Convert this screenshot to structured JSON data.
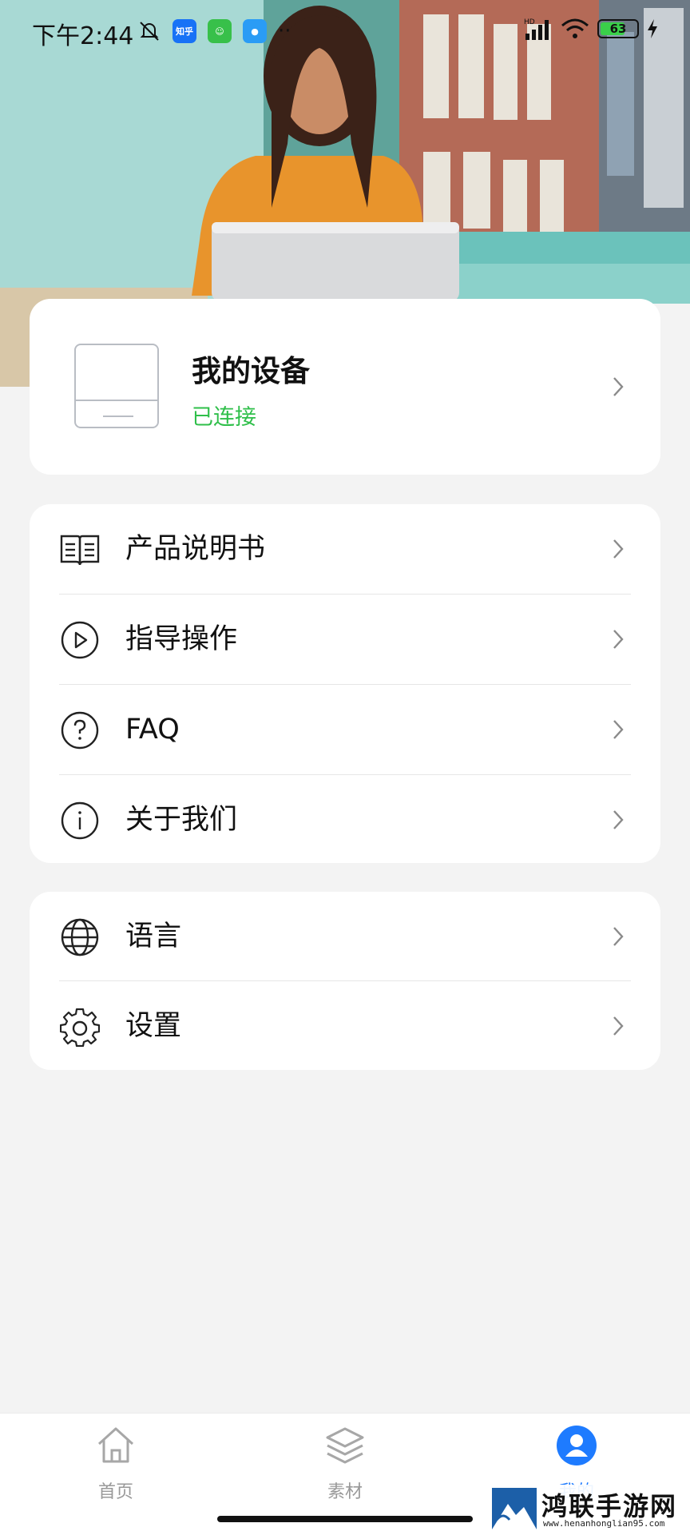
{
  "status_bar": {
    "time": "下午2:44",
    "network": "HD",
    "battery": "63"
  },
  "device": {
    "title": "我的设备",
    "status": "已连接"
  },
  "menu_group_1": [
    {
      "label": "产品说明书",
      "icon": "book-icon"
    },
    {
      "label": "指导操作",
      "icon": "play-circle-icon"
    },
    {
      "label": "FAQ",
      "icon": "question-circle-icon"
    },
    {
      "label": "关于我们",
      "icon": "info-circle-icon"
    }
  ],
  "menu_group_2": [
    {
      "label": "语言",
      "icon": "globe-icon"
    },
    {
      "label": "设置",
      "icon": "gear-icon"
    }
  ],
  "tabs": [
    {
      "label": "首页",
      "icon": "home-icon"
    },
    {
      "label": "素材",
      "icon": "layers-icon"
    },
    {
      "label": "我的",
      "icon": "profile-icon"
    }
  ],
  "watermark": {
    "title": "鸿联手游网",
    "url": "www.henanhonglian95.com"
  },
  "colors": {
    "accent": "#1e7bff",
    "connected": "#2fbf4a",
    "background": "#f3f3f3"
  }
}
